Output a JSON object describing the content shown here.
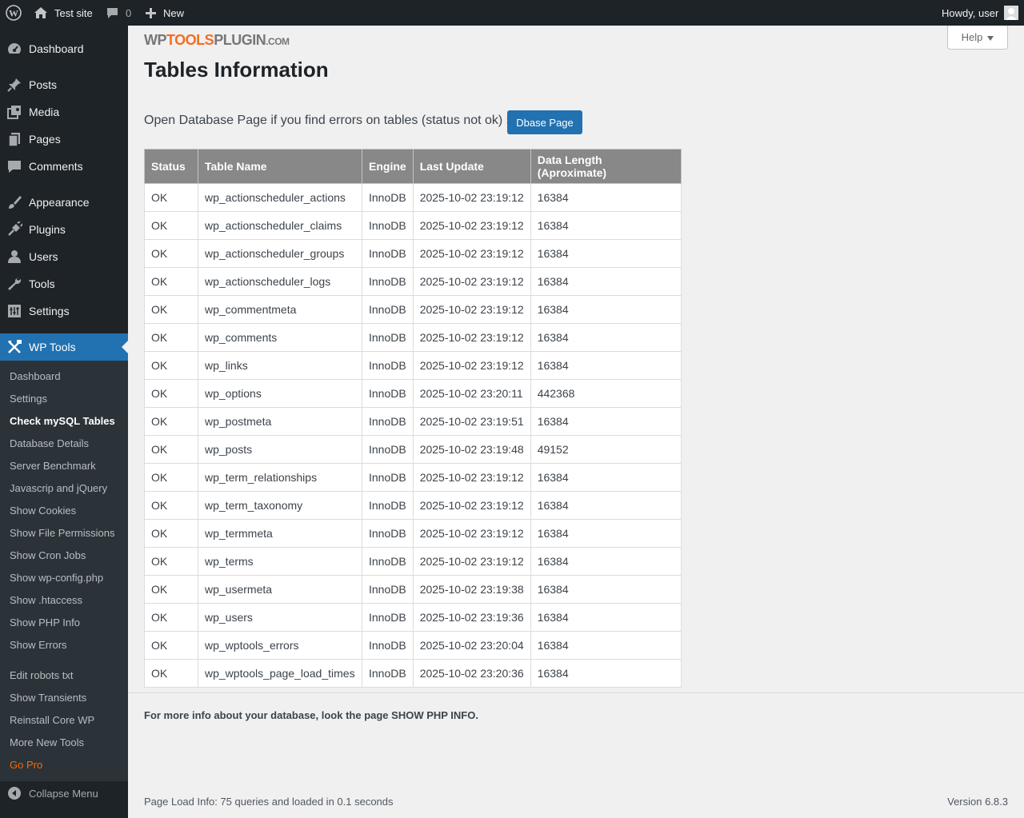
{
  "adminbar": {
    "site_name": "Test site",
    "comments_count": "0",
    "new_label": "New",
    "howdy": "Howdy, user"
  },
  "sidebar": {
    "items": [
      {
        "label": "Dashboard",
        "icon": "dashboard-icon"
      },
      {
        "label": "Posts",
        "icon": "pin-icon"
      },
      {
        "label": "Media",
        "icon": "media-icon"
      },
      {
        "label": "Pages",
        "icon": "pages-icon"
      },
      {
        "label": "Comments",
        "icon": "comment-icon"
      },
      {
        "label": "Appearance",
        "icon": "brush-icon"
      },
      {
        "label": "Plugins",
        "icon": "plug-icon"
      },
      {
        "label": "Users",
        "icon": "user-icon"
      },
      {
        "label": "Tools",
        "icon": "wrench-icon"
      },
      {
        "label": "Settings",
        "icon": "settings-icon"
      },
      {
        "label": "WP Tools",
        "icon": "tools-icon"
      }
    ],
    "submenu": [
      "Dashboard",
      "Settings",
      "Check mySQL Tables",
      "Database Details",
      "Server Benchmark",
      "Javascrip and jQuery",
      "Show Cookies",
      "Show File Permissions",
      "Show Cron Jobs",
      "Show wp-config.php",
      "Show .htaccess",
      "Show PHP Info",
      "Show Errors",
      "Edit robots txt",
      "Show Transients",
      "Reinstall Core WP",
      "More New Tools",
      "Go Pro"
    ],
    "collapse": "Collapse Menu"
  },
  "logo": {
    "wp": "WP",
    "tools": "TOOLS",
    "plugin": "PLUGIN",
    "com": ".COM"
  },
  "help_label": "Help",
  "page_title": "Tables Information",
  "intro_text": "Open Database Page if you find errors on tables (status not ok) »",
  "dbase_button": "Dbase Page",
  "table": {
    "headers": [
      "Status",
      "Table Name",
      "Engine",
      "Last Update",
      "Data Length (Aproximate)"
    ],
    "rows": [
      [
        "OK",
        "wp_actionscheduler_actions",
        "InnoDB",
        "2025-10-02 23:19:12",
        "16384"
      ],
      [
        "OK",
        "wp_actionscheduler_claims",
        "InnoDB",
        "2025-10-02 23:19:12",
        "16384"
      ],
      [
        "OK",
        "wp_actionscheduler_groups",
        "InnoDB",
        "2025-10-02 23:19:12",
        "16384"
      ],
      [
        "OK",
        "wp_actionscheduler_logs",
        "InnoDB",
        "2025-10-02 23:19:12",
        "16384"
      ],
      [
        "OK",
        "wp_commentmeta",
        "InnoDB",
        "2025-10-02 23:19:12",
        "16384"
      ],
      [
        "OK",
        "wp_comments",
        "InnoDB",
        "2025-10-02 23:19:12",
        "16384"
      ],
      [
        "OK",
        "wp_links",
        "InnoDB",
        "2025-10-02 23:19:12",
        "16384"
      ],
      [
        "OK",
        "wp_options",
        "InnoDB",
        "2025-10-02 23:20:11",
        "442368"
      ],
      [
        "OK",
        "wp_postmeta",
        "InnoDB",
        "2025-10-02 23:19:51",
        "16384"
      ],
      [
        "OK",
        "wp_posts",
        "InnoDB",
        "2025-10-02 23:19:48",
        "49152"
      ],
      [
        "OK",
        "wp_term_relationships",
        "InnoDB",
        "2025-10-02 23:19:12",
        "16384"
      ],
      [
        "OK",
        "wp_term_taxonomy",
        "InnoDB",
        "2025-10-02 23:19:12",
        "16384"
      ],
      [
        "OK",
        "wp_termmeta",
        "InnoDB",
        "2025-10-02 23:19:12",
        "16384"
      ],
      [
        "OK",
        "wp_terms",
        "InnoDB",
        "2025-10-02 23:19:12",
        "16384"
      ],
      [
        "OK",
        "wp_usermeta",
        "InnoDB",
        "2025-10-02 23:19:38",
        "16384"
      ],
      [
        "OK",
        "wp_users",
        "InnoDB",
        "2025-10-02 23:19:36",
        "16384"
      ],
      [
        "OK",
        "wp_wptools_errors",
        "InnoDB",
        "2025-10-02 23:20:04",
        "16384"
      ],
      [
        "OK",
        "wp_wptools_page_load_times",
        "InnoDB",
        "2025-10-02 23:20:36",
        "16384"
      ]
    ]
  },
  "more_info": "For more info about your database, look the page SHOW PHP INFO.",
  "footer": {
    "load_info": "Page Load Info: 75 queries and loaded in 0.1 seconds",
    "version": "Version 6.8.3"
  },
  "colors": {
    "adminbar_bg": "#1d2327",
    "accent": "#2271b1",
    "gopro": "#ff6600",
    "table_header_bg": "#888888"
  }
}
